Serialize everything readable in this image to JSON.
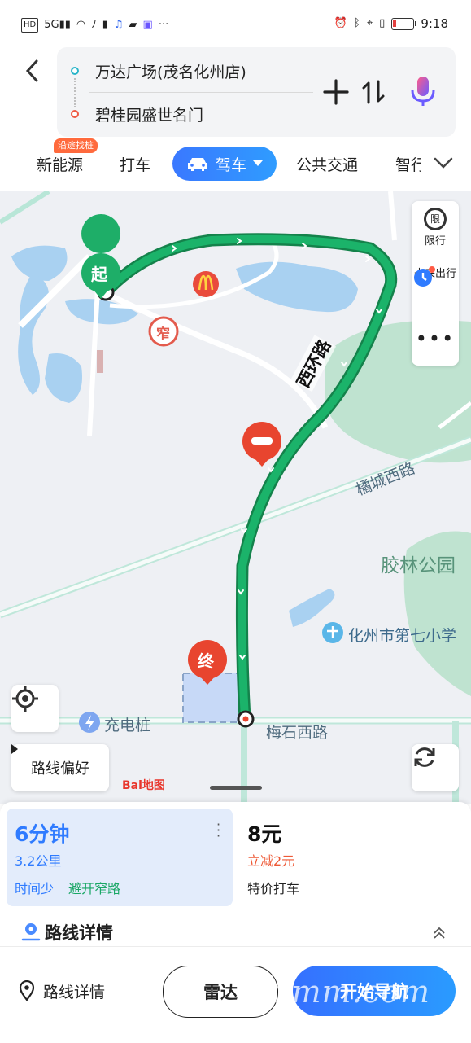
{
  "status_bar": {
    "left_icons": [
      "HD",
      "5G",
      "signal-icon",
      "wifi-icon",
      "nfc-icon",
      "battery-warn-icon",
      "music-app-icon",
      "notes-app-icon",
      "edu-app-icon",
      "more-dots"
    ],
    "time": "9:18"
  },
  "route": {
    "origin": "万达广场(茂名化州店)",
    "destination": "碧桂园盛世名门"
  },
  "tabs": {
    "new_energy": "新能源",
    "new_energy_badge": "沿途找桩",
    "taxi": "打车",
    "drive": "驾车",
    "transit": "公共交通",
    "smart": "智行"
  },
  "map": {
    "start_marker": "起",
    "end_marker": "终",
    "narrow_road_icon": "窄",
    "road_west_ring": "西环路",
    "road_jucheng_west": "橘城西路",
    "road_meishi_west": "梅石西路",
    "park_label": "胶林公园",
    "school_label": "化州市第七小学",
    "charging_label": "充电桩",
    "restrict_label": "限",
    "restrict_text": "限行",
    "future_text": "未来出行",
    "route_pref": "路线偏好",
    "baidu_logo": "Bai地图"
  },
  "plan_card": {
    "duration": "6分钟",
    "distance": "3.2公里",
    "tag_time": "时间少",
    "tag_avoid": "避开窄路"
  },
  "taxi_card": {
    "price": "8元",
    "discount": "立减2元",
    "label": "特价打车"
  },
  "route_details_header": "路线详情",
  "bottom_bar": {
    "details": "路线详情",
    "radar": "雷达",
    "start_nav": "开始导航",
    "watermark": "gdmm.com"
  },
  "colors": {
    "route_green": "#0fa35a",
    "accent_blue": "#2f7bff",
    "marker_red": "#e8452f"
  }
}
